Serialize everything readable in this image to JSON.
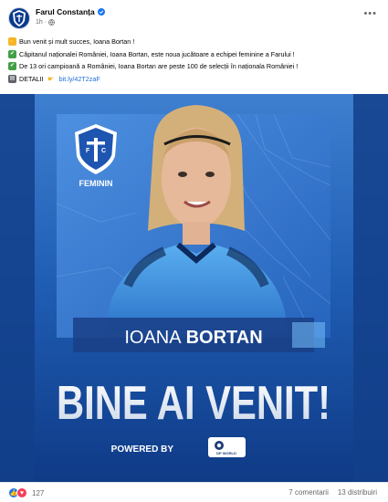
{
  "header": {
    "page_name": "Farul Constanța",
    "timestamp": "1h",
    "more_label": "•••"
  },
  "post": {
    "lines": [
      {
        "emoji": "wave",
        "text": "Bun venit și mult succes, Ioana Bortan !"
      },
      {
        "emoji": "check",
        "text": "Căpitanul naționalei României, Ioana Bortan, este noua jucătoare a echipei feminine a Farului !"
      },
      {
        "emoji": "check",
        "text": "De 13 ori campioană a României, Ioana Bortan are peste 100 de selecții în naționala României !"
      }
    ],
    "details_label": "DETALII",
    "details_link": "bit.ly/42T2zaF"
  },
  "media": {
    "team_label": "FEMININ",
    "player_first": "IOANA",
    "player_last": "BORTAN",
    "headline": "BINE AI VENIT!",
    "powered_by": "POWERED BY",
    "sponsor": "DP WORLD"
  },
  "footer": {
    "reaction_count": "127",
    "comments": "7 comentarii",
    "shares": "13 distribuiri"
  },
  "colors": {
    "brand_blue": "#154a9c",
    "link": "#216fdb",
    "like": "#1877f2",
    "love": "#f33e58"
  }
}
